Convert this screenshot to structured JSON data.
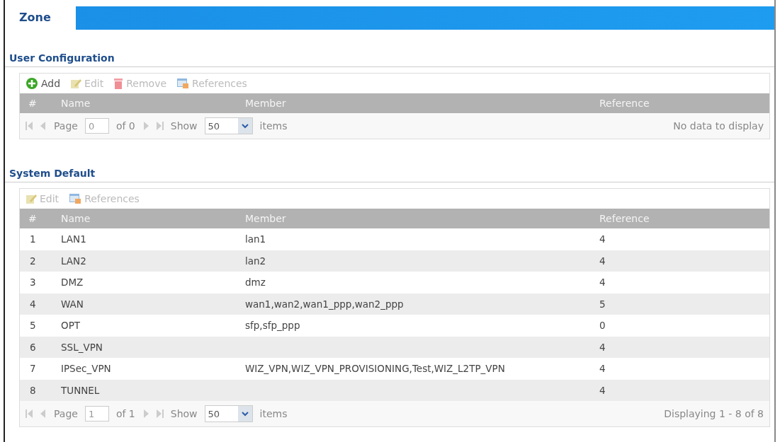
{
  "tabs": [
    {
      "label": "Zone",
      "selected": true
    }
  ],
  "sections": [
    {
      "title": "User Configuration",
      "toolbar": [
        {
          "kind": "add",
          "label": "Add",
          "disabled": false
        },
        {
          "kind": "edit",
          "label": "Edit",
          "disabled": true
        },
        {
          "kind": "remove",
          "label": "Remove",
          "disabled": true
        },
        {
          "kind": "references",
          "label": "References",
          "disabled": true
        }
      ],
      "columns": [
        "#",
        "Name",
        "Member",
        "Reference"
      ],
      "pager": {
        "page_label": "Page",
        "page": "0",
        "of": "of 0",
        "show": "Show",
        "per_page": "50",
        "items": "items",
        "status": "No data to display"
      }
    },
    {
      "title": "System Default",
      "toolbar": [
        {
          "kind": "edit",
          "label": "Edit",
          "disabled": true
        },
        {
          "kind": "references",
          "label": "References",
          "disabled": true
        }
      ],
      "columns": [
        "#",
        "Name",
        "Member",
        "Reference"
      ],
      "rows": [
        {
          "cells": [
            "1",
            "LAN1",
            "lan1",
            "4"
          ]
        },
        {
          "cells": [
            "2",
            "LAN2",
            "lan2",
            "4"
          ]
        },
        {
          "cells": [
            "3",
            "DMZ",
            "dmz",
            "4"
          ]
        },
        {
          "cells": [
            "4",
            "WAN",
            "wan1,wan2,wan1_ppp,wan2_ppp",
            "5"
          ]
        },
        {
          "cells": [
            "5",
            "OPT",
            "sfp,sfp_ppp",
            "0"
          ]
        },
        {
          "cells": [
            "6",
            "SSL_VPN",
            "",
            "4"
          ]
        },
        {
          "cells": [
            "7",
            "IPSec_VPN",
            "WIZ_VPN,WIZ_VPN_PROVISIONING,Test,WIZ_L2TP_VPN",
            "4"
          ]
        },
        {
          "cells": [
            "8",
            "TUNNEL",
            "",
            "4"
          ]
        }
      ],
      "pager": {
        "page_label": "Page",
        "page": "1",
        "of": "of 1",
        "show": "Show",
        "per_page": "50",
        "items": "items",
        "status": "Displaying 1 - 8 of 8"
      }
    }
  ]
}
